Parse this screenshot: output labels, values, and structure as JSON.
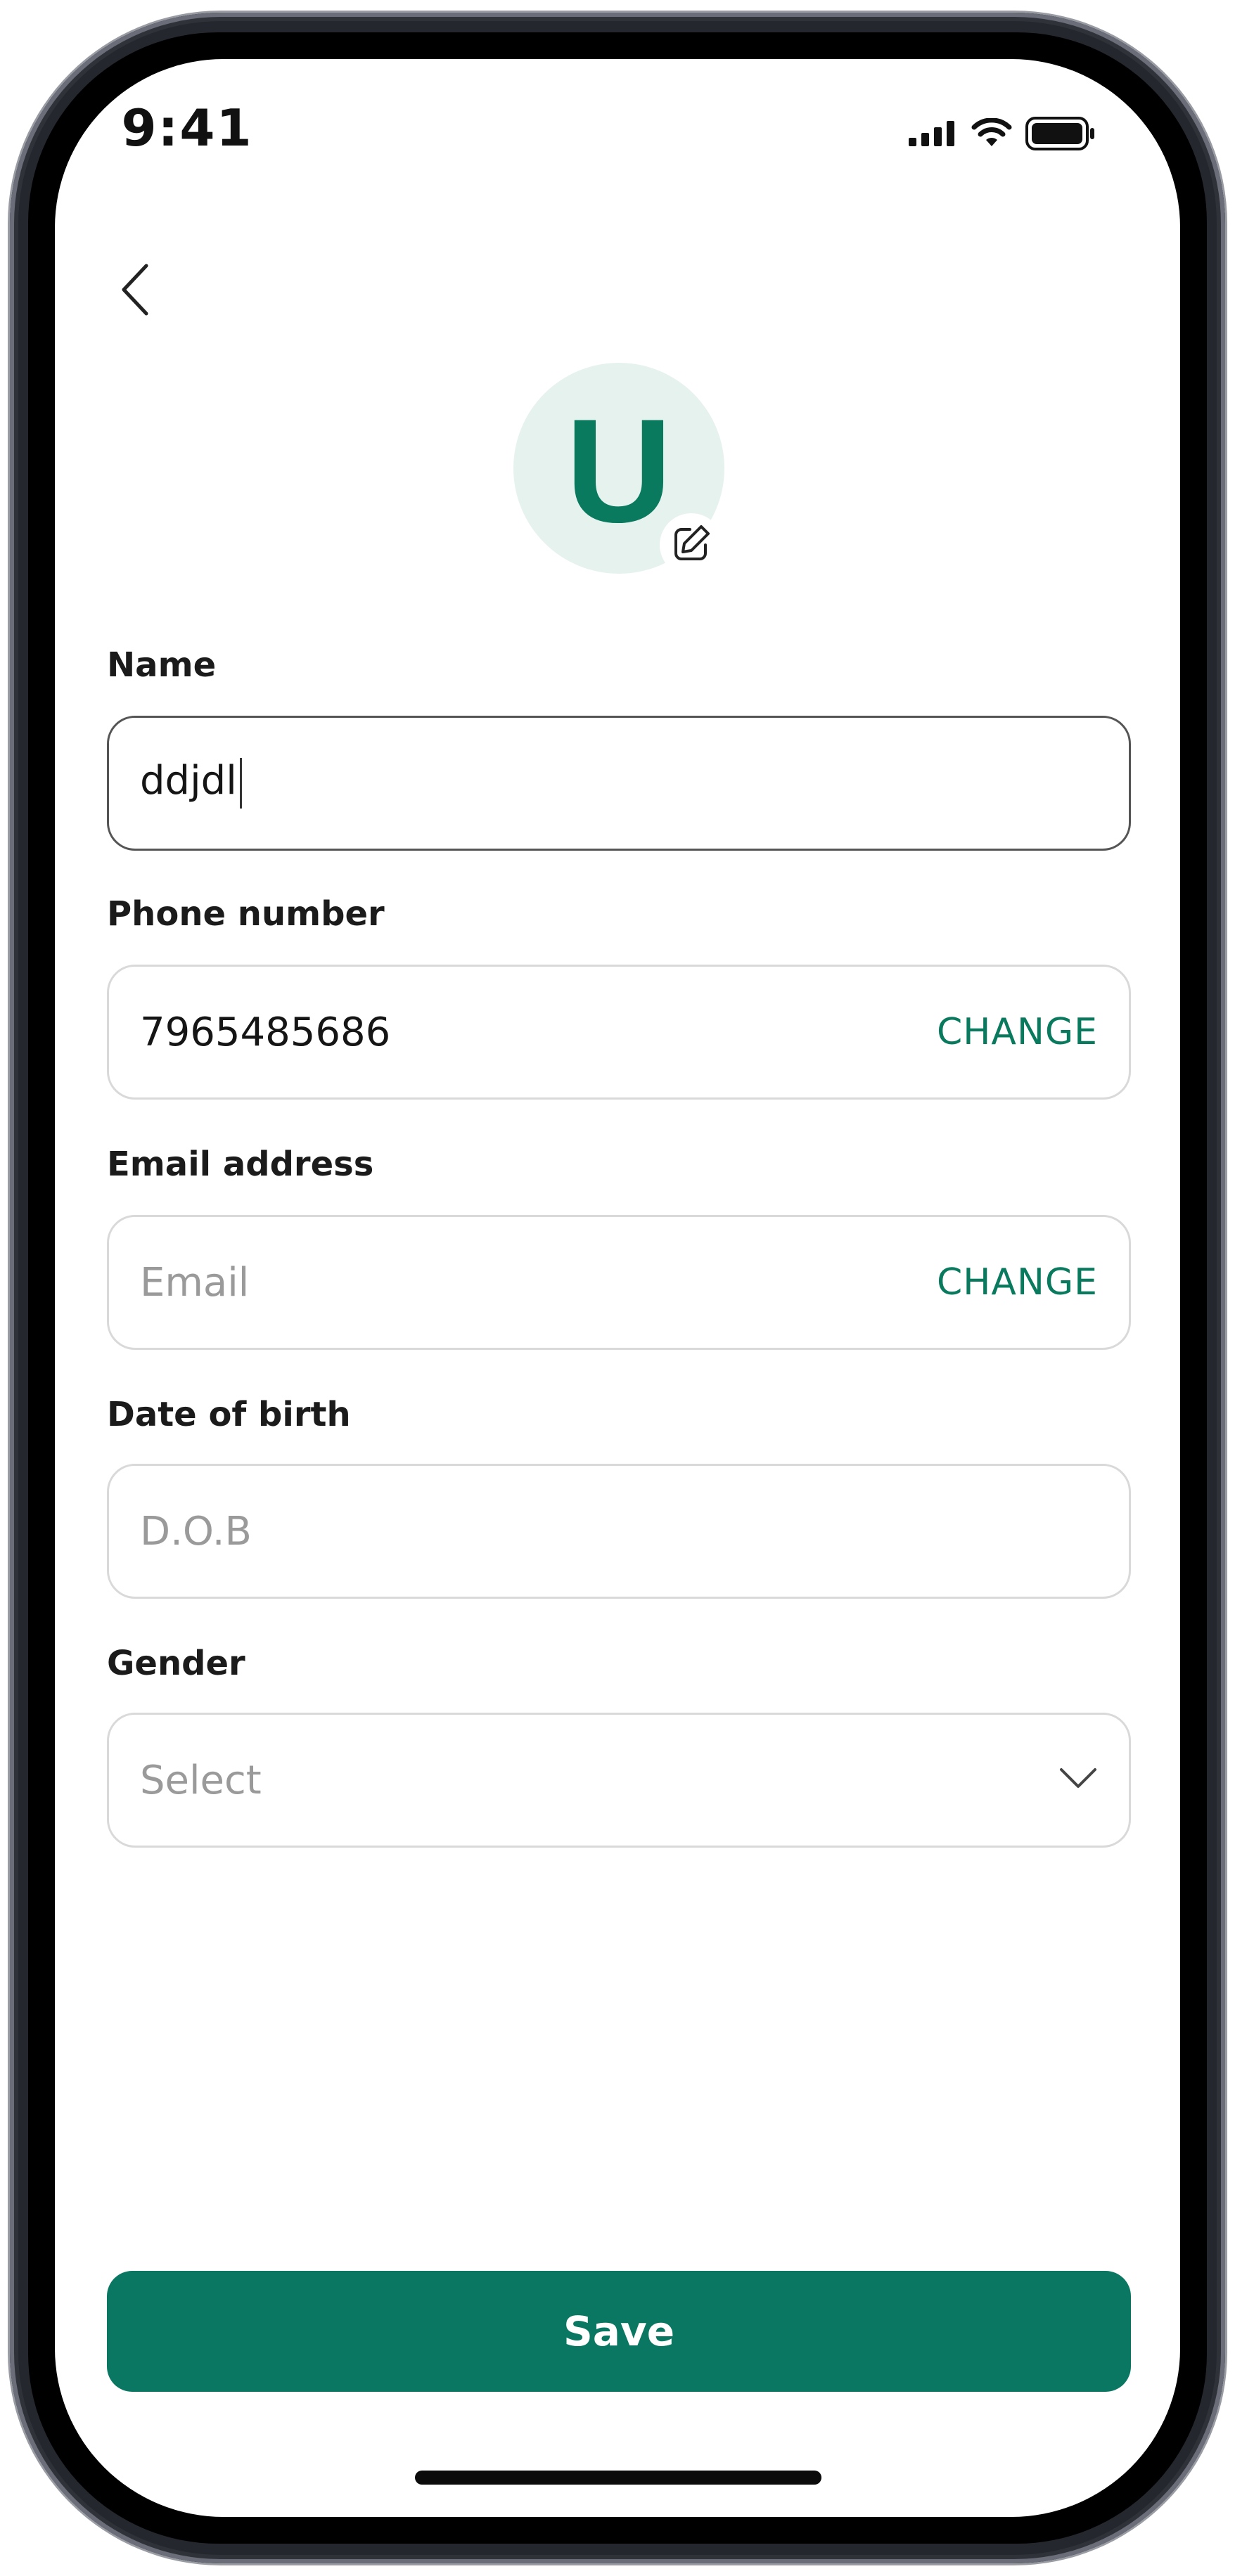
{
  "status_bar": {
    "time": "9:41"
  },
  "avatar": {
    "initial": "U"
  },
  "form": {
    "name": {
      "label": "Name",
      "value": "ddjdl"
    },
    "phone": {
      "label": "Phone number",
      "value": "7965485686",
      "action": "CHANGE"
    },
    "email": {
      "label": "Email address",
      "placeholder": "Email",
      "action": "CHANGE"
    },
    "dob": {
      "label": "Date of birth",
      "placeholder": "D.O.B"
    },
    "gender": {
      "label": "Gender",
      "placeholder": "Select"
    }
  },
  "actions": {
    "save_label": "Save"
  },
  "colors": {
    "accent": "#0a7762",
    "avatar_bg": "#e6f2ee"
  },
  "icons": [
    "back-icon",
    "edit-icon",
    "chevron-down-icon",
    "signal-icon",
    "wifi-icon",
    "battery-icon"
  ]
}
